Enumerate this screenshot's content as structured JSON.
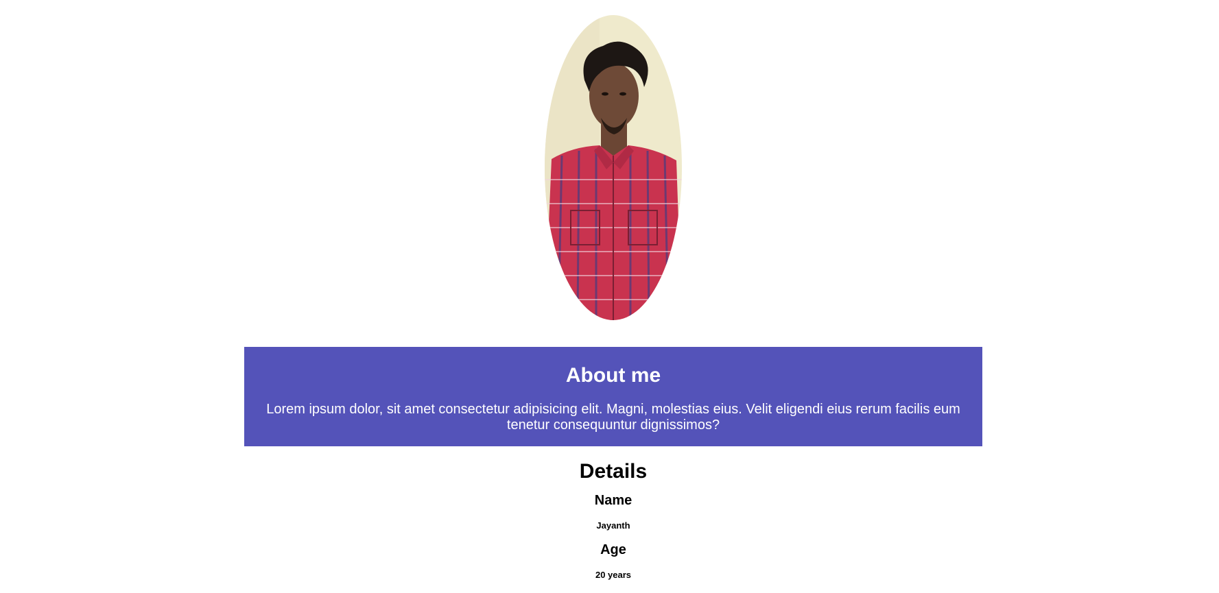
{
  "about": {
    "heading": "About me",
    "text": "Lorem ipsum dolor, sit amet consectetur adipisicing elit. Magni, molestias eius. Velit eligendi eius rerum facilis eum tenetur consequuntur dignissimos?",
    "background": "#5453b9"
  },
  "details": {
    "heading": "Details",
    "fields": [
      {
        "label": "Name",
        "value": "Jayanth"
      },
      {
        "label": "Age",
        "value": "20 years"
      }
    ]
  }
}
